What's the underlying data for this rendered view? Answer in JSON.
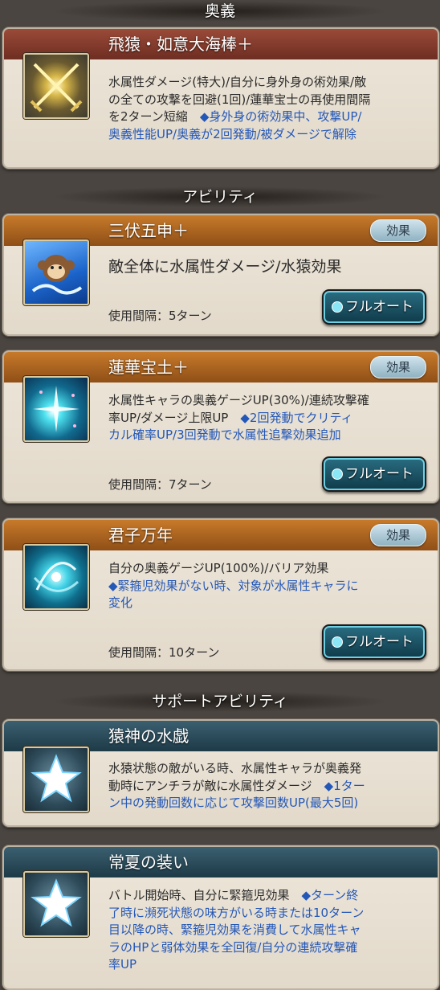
{
  "sections": {
    "ougi": "奥義",
    "ability": "アビリティ",
    "support": "サポートアビリティ"
  },
  "ougi": {
    "title": "飛猿・如意大海棒＋",
    "desc_lines": [
      "水属性ダメージ(特大)/自分に身外身の術効果/敵",
      "の全ての攻撃を回避(1回)/蓮華宝士の再使用間隔"
    ],
    "desc_line3_black": "を2ターン短縮",
    "desc_line3_blue": "◆身外身の術効果中、攻撃UP/",
    "desc_line4_blue": "奥義性能UP/奥義が2回発動/被ダメージで解除",
    "icon": "crossed-swords-icon"
  },
  "abilities": [
    {
      "title": "三伏五申＋",
      "effect_label": "効果",
      "desc": "敵全体に水属性ダメージ/水猿効果",
      "interval": "使用間隔：5ターン",
      "auto_label": "フルオート",
      "icon": "monkey-icon"
    },
    {
      "title": "蓮華宝土＋",
      "effect_label": "効果",
      "desc_line1": "水属性キャラの奥義ゲージUP(30%)/連続攻撃確",
      "desc_line2_black": "率UP/ダメージ上限UP",
      "desc_line2_blue": "◆2回発動でクリティ",
      "desc_line3_blue": "カル確率UP/3回発動で水属性追撃効果追加",
      "interval": "使用間隔：7ターン",
      "auto_label": "フルオート",
      "icon": "sparkle-burst-icon"
    },
    {
      "title": "君子万年",
      "effect_label": "効果",
      "desc_line1": "自分の奥義ゲージUP(100%)/バリア効果",
      "desc_line2_blue": "◆緊箍児効果がない時、対象が水属性キャラに",
      "desc_line3_blue": "変化",
      "interval": "使用間隔：10ターン",
      "auto_label": "フルオート",
      "icon": "water-swirl-icon"
    }
  ],
  "supports": [
    {
      "title": "猿神の水戯",
      "desc_line1": "水猿状態の敵がいる時、水属性キャラが奥義発",
      "desc_line2_black": "動時にアンチラが敵に水属性ダメージ",
      "desc_line2_blue": "◆1ター",
      "desc_line3_blue": "ン中の発動回数に応じて攻撃回数UP(最大5回)",
      "icon": "star-icon"
    },
    {
      "title": "常夏の装い",
      "desc_line1_black": "バトル開始時、自分に緊箍児効果",
      "desc_line1_blue": "◆ターン終",
      "desc_line2_blue": "了時に瀕死状態の味方がいる時または10ターン",
      "desc_line3_blue": "目以降の時、緊箍児効果を消費して水属性キャ",
      "desc_line4_blue": "ラのHPと弱体効果を全回復/自分の連続攻撃確",
      "desc_line5_blue": "率UP",
      "icon": "star-icon"
    }
  ]
}
